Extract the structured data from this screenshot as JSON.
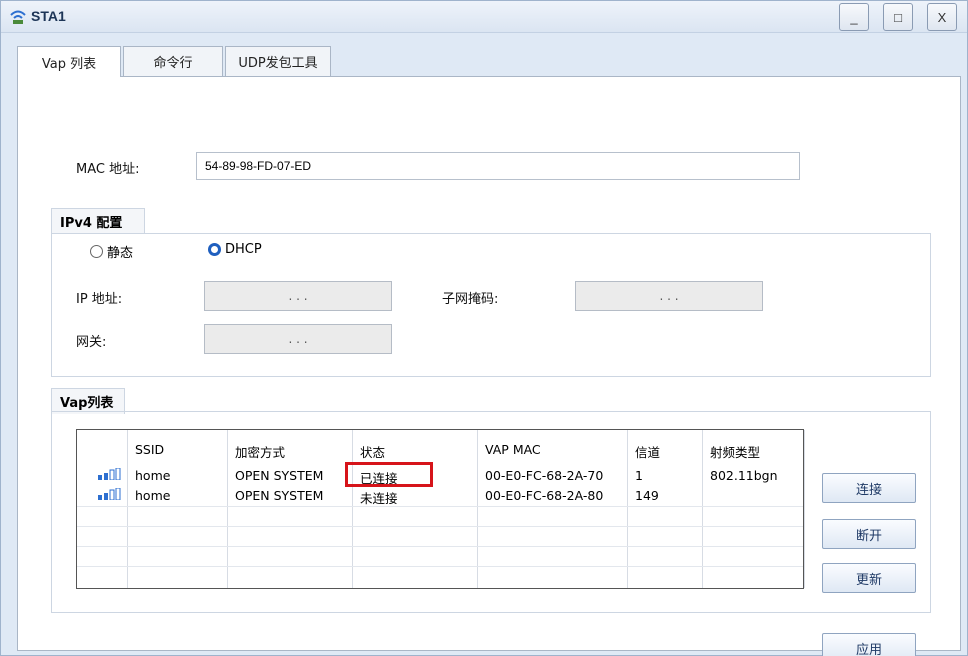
{
  "window": {
    "title": "STA1",
    "minimize": "_",
    "maximize": "□",
    "close": "X"
  },
  "tabs": [
    {
      "label": "Vap 列表"
    },
    {
      "label": "命令行"
    },
    {
      "label": "UDP发包工具"
    }
  ],
  "mac": {
    "label": "MAC 地址:",
    "value": "54-89-98-FD-07-ED"
  },
  "ipv4": {
    "group_title": "IPv4 配置",
    "radio_static": "静态",
    "radio_dhcp": "DHCP",
    "ip_label": "IP 地址:",
    "subnet_label": "子网掩码:",
    "gateway_label": "网关:",
    "ip_dots": ".   .   .",
    "subnet_dots": ".   .   .",
    "gateway_dots": ".   .   ."
  },
  "vap": {
    "group_title": "Vap列表",
    "columns": [
      "SSID",
      "加密方式",
      "状态",
      "VAP MAC",
      "信道",
      "射频类型"
    ],
    "rows": [
      {
        "ssid": "home",
        "encryption": "OPEN SYSTEM",
        "status": "已连接",
        "mac": "00-E0-FC-68-2A-70",
        "channel": "1",
        "radio": "802.11bgn"
      },
      {
        "ssid": "home",
        "encryption": "OPEN SYSTEM",
        "status": "未连接",
        "mac": "00-E0-FC-68-2A-80",
        "channel": "149",
        "radio": ""
      }
    ]
  },
  "buttons": {
    "connect": "连接",
    "disconnect": "断开",
    "refresh": "更新",
    "apply": "应用"
  },
  "colors": {
    "accent": "#1f5fbf",
    "highlight": "#d6141a",
    "signal": "#2d6fd0"
  }
}
